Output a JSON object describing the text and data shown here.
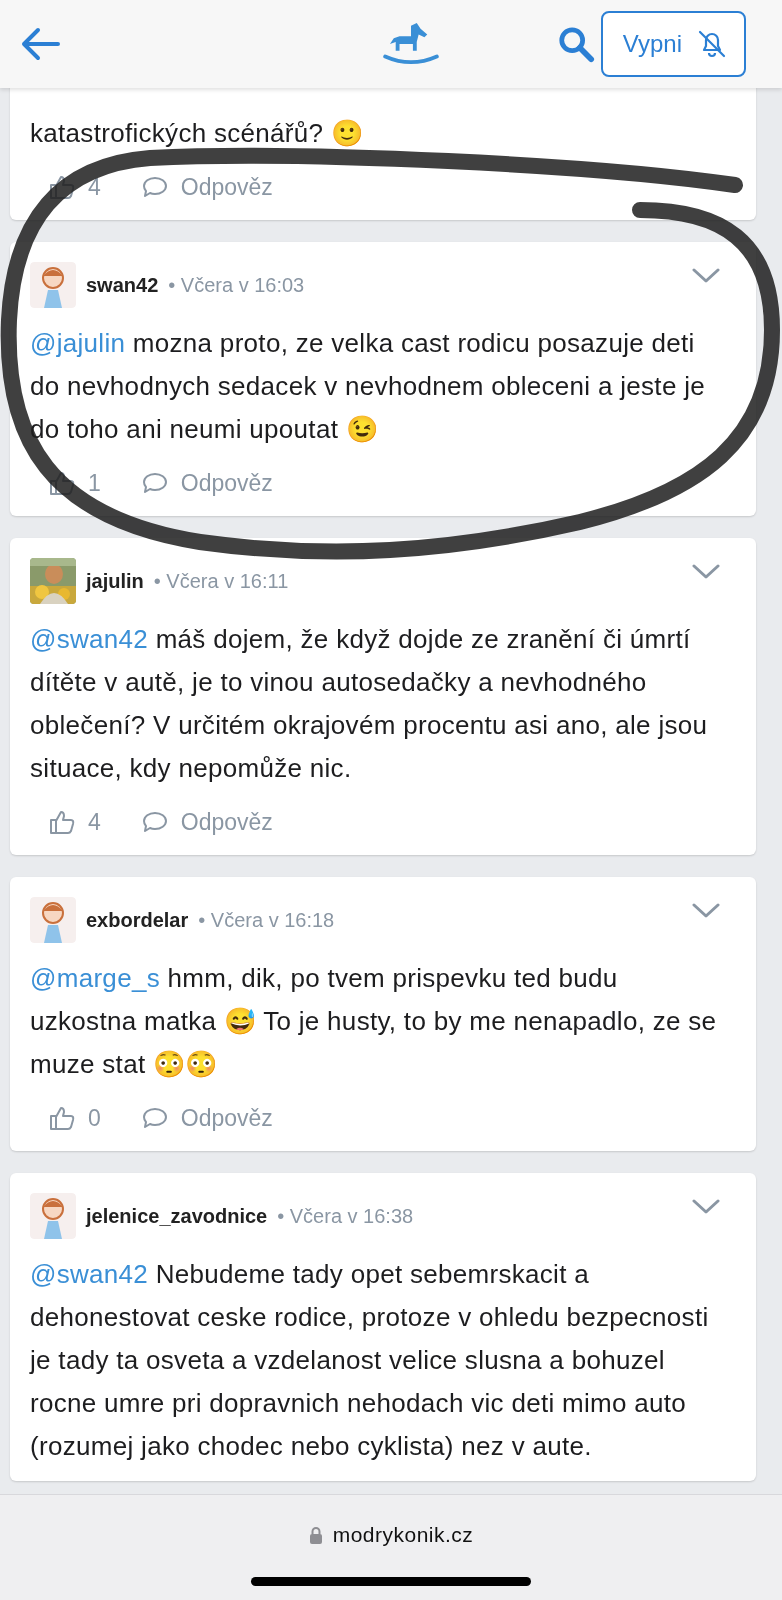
{
  "header": {
    "button_label": "Vypni"
  },
  "comments": [
    {
      "text": "katastrofických scénářů? 🙂",
      "likes": "4",
      "reply": "Odpověz"
    },
    {
      "author": "swan42",
      "time": "• Včera v 16:03",
      "avatar": {
        "kind": "cartoon"
      },
      "mention": "@jajulin",
      "text": "mozna proto, ze velka cast rodicu posazuje deti do nevhodnych sedacek v nevhodnem obleceni a jeste je do toho ani neumi upoutat 😉",
      "likes": "1",
      "reply": "Odpověz"
    },
    {
      "author": "jajulin",
      "time": "• Včera v 16:11",
      "mention": "@swan42",
      "text": "máš dojem, že když dojde ze zranění či úmrtí dítěte v autě, je to vinou autosedačky a nevhodného oblečení? V určitém okrajovém procentu asi ano, ale jsou situace, kdy nepomůže nic.",
      "likes": "4",
      "reply": "Odpověz"
    },
    {
      "author": "exbordelar",
      "time": "• Včera v 16:18",
      "avatar": {
        "kind": "cartoon"
      },
      "mention": "@marge_s",
      "text": "hmm, dik, po tvem prispevku ted budu uzkostna matka 😅 To je husty, to by me nenapadlo, ze se muze stat 😳😳",
      "likes": "0",
      "reply": "Odpověz"
    },
    {
      "author": "jelenice_zavodnice",
      "time": "• Včera v 16:38",
      "avatar": {
        "kind": "cartoon"
      },
      "mention": "@swan42",
      "text": "Nebudeme tady opet sebemrskacit a dehonestovat ceske rodice, protoze v ohledu bezpecnosti je tady ta osveta a vzdelanost velice slusna a bohuzel rocne umre pri dopravnich nehodach vic deti mimo auto (rozumej jako chodec nebo cyklista) nez v aute."
    }
  ],
  "address_bar": {
    "url": "modrykonik.cz"
  }
}
